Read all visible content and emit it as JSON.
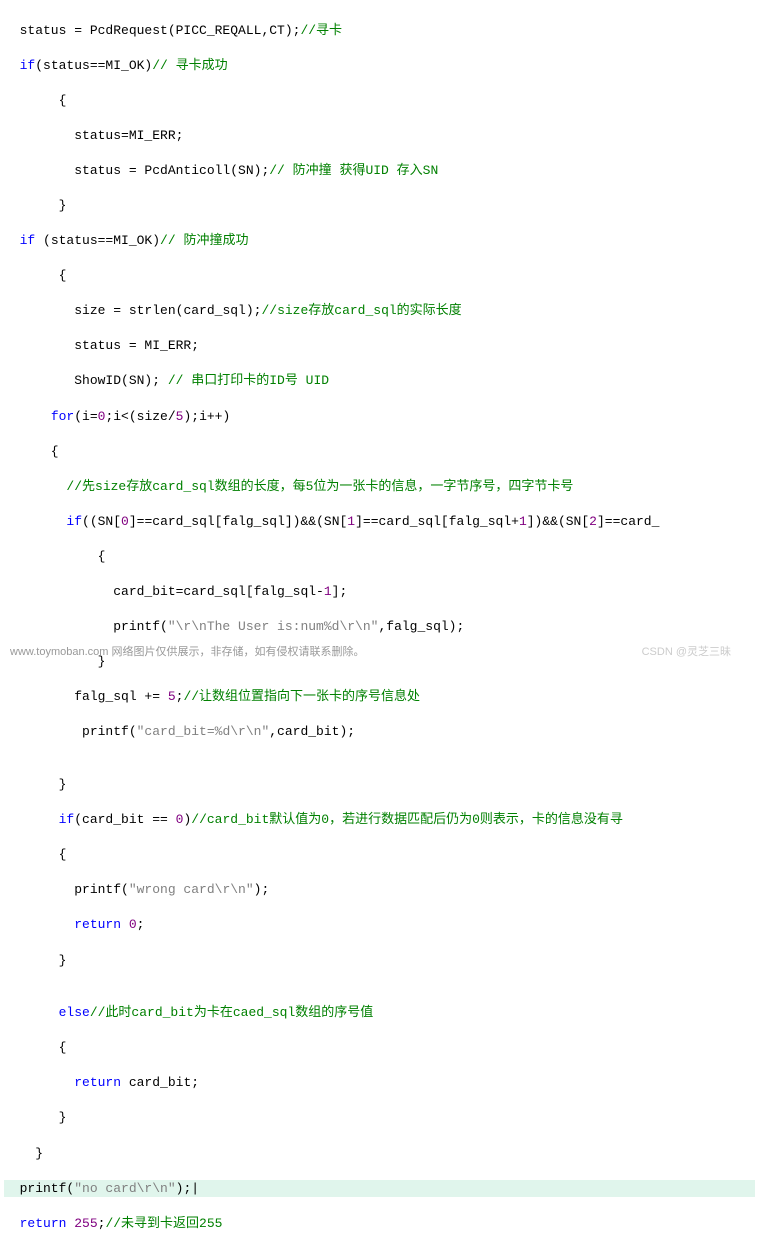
{
  "code": {
    "l1": "  status = PcdRequest(PICC_REQALL,CT);",
    "l1c": "//寻卡",
    "l2a": "  ",
    "l2kw": "if",
    "l2b": "(status==MI_OK)",
    "l2c": "// 寻卡成功",
    "l3": "       {",
    "l4": "         status=MI_ERR;",
    "l5": "         status = PcdAnticoll(SN);",
    "l5c": "// 防冲撞 获得UID 存入SN",
    "l6": "       }",
    "l7a": "  ",
    "l7kw": "if",
    "l7b": " (status==MI_OK)",
    "l7c": "// 防冲撞成功",
    "l8": "       {",
    "l9a": "         size = strlen(",
    "l9err": "card_sql",
    "l9b": ");",
    "l9c": "//size存放card_sql的实际长度",
    "l10": "         status = MI_ERR;",
    "l11a": "         ShowID(SN);",
    "l11c": " // 串口打印卡的ID号 UID",
    "l12a": "      ",
    "l12kw": "for",
    "l12b": "(i=",
    "l12n1": "0",
    "l12c": ";i<(size/",
    "l12n2": "5",
    "l12d": ");i++)",
    "l13": "      {",
    "l14c": "        //先size存放card_sql数组的长度，每5位为一张卡的信息，一字节序号，四字节卡号",
    "l15a": "        ",
    "l15kw": "if",
    "l15b": "((SN[",
    "l15n1": "0",
    "l15c": "]==card_sql[falg_sql])&&(SN[",
    "l15n2": "1",
    "l15d": "]==card_sql[falg_sql+",
    "l15n3": "1",
    "l15e": "])&&(SN[",
    "l15n4": "2",
    "l15f": "]==card_",
    "l16": "            {",
    "l17a": "              card_bit=card_sql[falg_sql-",
    "l17n": "1",
    "l17b": "];",
    "l18a": "              printf(",
    "l18s": "\"\\r\\nThe User is:num%d\\r\\n\"",
    "l18b": ",falg_sql);",
    "l19": "            }",
    "l20a": "         falg_sql += ",
    "l20n": "5",
    "l20b": ";",
    "l20c": "//让数组位置指向下一张卡的序号信息处",
    "l21a": "          printf(",
    "l21s": "\"card_bit=%d\\r\\n\"",
    "l21b": ",card_bit);",
    "l22": "",
    "l23": "       }",
    "l24a": "       ",
    "l24kw": "if",
    "l24b": "(card_bit == ",
    "l24n": "0",
    "l24c": ")",
    "l24cm": "//card_bit默认值为0，若进行数据匹配后仍为0则表示，卡的信息没有寻",
    "l25": "       {",
    "l26a": "         printf(",
    "l26s": "\"wrong card\\r\\n\"",
    "l26b": ");",
    "l27a": "         ",
    "l27kw": "return",
    "l27b": " ",
    "l27n": "0",
    "l27c": ";",
    "l28": "       }",
    "l29": "",
    "l30a": "       ",
    "l30kw": "else",
    "l30c": "//此时card_bit为卡在caed_sql数组的序号值",
    "l31": "       {",
    "l32a": "         ",
    "l32kw": "return",
    "l32b": " card_bit;",
    "l33": "       }",
    "l34": "    }",
    "l35a": "  printf(",
    "l35s": "\"no card\\r\\n\"",
    "l35b": ");",
    "l35cur": "|",
    "l36a": "  ",
    "l36kw": "return",
    "l36b": " ",
    "l36n": "255",
    "l36c": ";",
    "l36cm": "//未寻到卡返回255"
  },
  "footer": "www.toymoban.com 网络图片仅供展示，非存储，如有侵权请联系删除。",
  "csdn": "CSDN @灵芝三昧"
}
